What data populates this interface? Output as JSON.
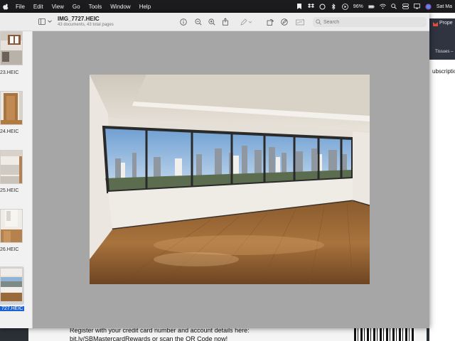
{
  "menubar": {
    "items": [
      "File",
      "Edit",
      "View",
      "Go",
      "Tools",
      "Window",
      "Help"
    ],
    "battery": "96%",
    "clock": "Sat Ma"
  },
  "window": {
    "title": "IMG_7727.HEIC",
    "subtitle": "43 documents, 43 total pages",
    "search_placeholder": "Search"
  },
  "sidebar": {
    "thumbnails": [
      {
        "label": "23.HEIC",
        "selected": false
      },
      {
        "label": "24.HEIC",
        "selected": false
      },
      {
        "label": "25.HEIC",
        "selected": false
      },
      {
        "label": "26.HEIC",
        "selected": false
      },
      {
        "label": "727.HEIC",
        "selected": true
      }
    ]
  },
  "background": {
    "tab_title": "Prope",
    "tab2": "Tissues –",
    "sub_text": "ubscriptio",
    "bottom_line1": "Register with your credit card number and account details here:",
    "bottom_line2": "bit.ly/SBMastercardRewards or scan the QR Code now!"
  },
  "colors": {
    "accent": "#1a63d6",
    "canvas": "#a6a6a6",
    "menubar": "#1c1c1e"
  }
}
